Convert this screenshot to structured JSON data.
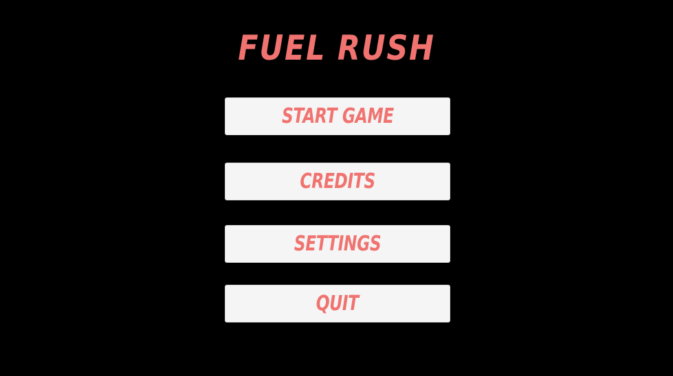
{
  "title": "FUEL RUSH",
  "menu": {
    "start_label": "START GAME",
    "credits_label": "CREDITS",
    "settings_label": "SETTINGS",
    "quit_label": "QUIT"
  },
  "colors": {
    "background": "#000000",
    "accent": "#f07370",
    "button_bg": "#f5f5f5"
  }
}
